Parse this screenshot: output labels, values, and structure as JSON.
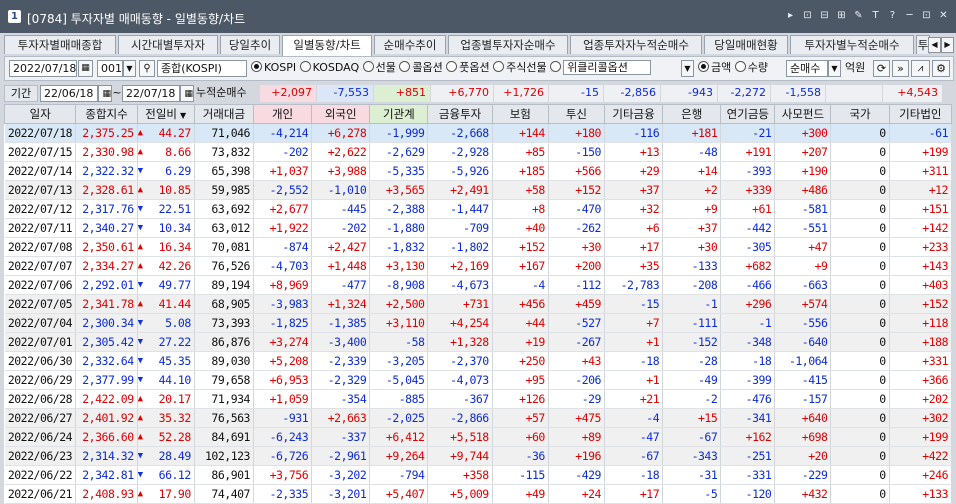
{
  "window": {
    "screen_no": "[0784]",
    "title": "투자자별 매매동향 - 일별동향/차트",
    "controls": [
      "▸",
      "⊡",
      "⊟",
      "⊞",
      "✎",
      "T",
      "?",
      "─",
      "⊡",
      "✕"
    ]
  },
  "tabs": [
    "투자자별매매종합",
    "시간대별투자자",
    "당일추이",
    "일별동향/차트",
    "순매수추이",
    "업종별투자자순매수",
    "업종투자자누적순매수",
    "당일매매현황",
    "투자자별누적순매수",
    "투"
  ],
  "active_tab": "일별동향/차트",
  "toolbar": {
    "date": "2022/07/18",
    "code": "001",
    "index_name": "종합(KOSPI)",
    "markets": [
      "KOSPI",
      "KOSDAQ",
      "선물",
      "콜옵션",
      "풋옵션",
      "주식선물",
      "위클리콜옵션"
    ],
    "market_selected": "KOSPI",
    "amount_types": [
      "금액",
      "수량"
    ],
    "amount_selected": "금액",
    "mode": "순매수",
    "unit": "억원"
  },
  "summary": {
    "period_label": "기간",
    "from": "22/06/18",
    "to": "22/07/18",
    "cum_label": "누적순매수",
    "values": [
      "+2,097",
      "-7,553",
      "+851",
      "+6,770",
      "+1,726",
      "-15",
      "-2,856",
      "-943",
      "-2,272",
      "-1,558",
      "",
      "+4,543"
    ]
  },
  "columns": [
    "일자",
    "종합지수",
    "전일비",
    "거래대금",
    "개인",
    "외국인",
    "기관계",
    "금융투자",
    "보험",
    "투신",
    "기타금융",
    "은행",
    "연기금등",
    "사모펀드",
    "국가",
    "기타법인"
  ],
  "rows": [
    [
      "2022/07/18",
      "2,375.25",
      "up",
      "44.27",
      "71,046",
      "-4,214",
      "+6,278",
      "-1,999",
      "-2,668",
      "+144",
      "+180",
      "-116",
      "+181",
      "-21",
      "+300",
      "0",
      "-61"
    ],
    [
      "2022/07/15",
      "2,330.98",
      "up",
      "8.66",
      "73,832",
      "-202",
      "+2,622",
      "-2,629",
      "-2,928",
      "+85",
      "-150",
      "+13",
      "-48",
      "+191",
      "+207",
      "0",
      "+199"
    ],
    [
      "2022/07/14",
      "2,322.32",
      "dn",
      "6.29",
      "65,398",
      "+1,037",
      "+3,988",
      "-5,335",
      "-5,926",
      "+185",
      "+566",
      "+29",
      "+14",
      "-393",
      "+190",
      "0",
      "+311"
    ],
    [
      "2022/07/13",
      "2,328.61",
      "up",
      "10.85",
      "59,985",
      "-2,552",
      "-1,010",
      "+3,565",
      "+2,491",
      "+58",
      "+152",
      "+37",
      "+2",
      "+339",
      "+486",
      "0",
      "+12"
    ],
    [
      "2022/07/12",
      "2,317.76",
      "dn",
      "22.51",
      "63,692",
      "+2,677",
      "-445",
      "-2,388",
      "-1,447",
      "+8",
      "-470",
      "+32",
      "+9",
      "+61",
      "-581",
      "0",
      "+151"
    ],
    [
      "2022/07/11",
      "2,340.27",
      "dn",
      "10.34",
      "63,012",
      "+1,922",
      "-202",
      "-1,880",
      "-709",
      "+40",
      "-262",
      "+6",
      "+37",
      "-442",
      "-551",
      "0",
      "+142"
    ],
    [
      "2022/07/08",
      "2,350.61",
      "up",
      "16.34",
      "70,081",
      "-874",
      "+2,427",
      "-1,832",
      "-1,802",
      "+152",
      "+30",
      "+17",
      "+30",
      "-305",
      "+47",
      "0",
      "+233"
    ],
    [
      "2022/07/07",
      "2,334.27",
      "up",
      "42.26",
      "76,526",
      "-4,703",
      "+1,448",
      "+3,130",
      "+2,169",
      "+167",
      "+200",
      "+35",
      "-133",
      "+682",
      "+9",
      "0",
      "+143"
    ],
    [
      "2022/07/06",
      "2,292.01",
      "dn",
      "49.77",
      "89,194",
      "+8,969",
      "-477",
      "-8,908",
      "-4,673",
      "-4",
      "-112",
      "-2,783",
      "-208",
      "-466",
      "-663",
      "0",
      "+403"
    ],
    [
      "2022/07/05",
      "2,341.78",
      "up",
      "41.44",
      "68,905",
      "-3,983",
      "+1,324",
      "+2,500",
      "+731",
      "+456",
      "+459",
      "-15",
      "-1",
      "+296",
      "+574",
      "0",
      "+152"
    ],
    [
      "2022/07/04",
      "2,300.34",
      "dn",
      "5.08",
      "73,393",
      "-1,825",
      "-1,385",
      "+3,110",
      "+4,254",
      "+44",
      "-527",
      "+7",
      "-111",
      "-1",
      "-556",
      "0",
      "+118"
    ],
    [
      "2022/07/01",
      "2,305.42",
      "dn",
      "27.22",
      "86,876",
      "+3,274",
      "-3,400",
      "-58",
      "+1,328",
      "+19",
      "-267",
      "+1",
      "-152",
      "-348",
      "-640",
      "0",
      "+188"
    ],
    [
      "2022/06/30",
      "2,332.64",
      "dn",
      "45.35",
      "89,030",
      "+5,208",
      "-2,339",
      "-3,205",
      "-2,370",
      "+250",
      "+43",
      "-18",
      "-28",
      "-18",
      "-1,064",
      "0",
      "+331"
    ],
    [
      "2022/06/29",
      "2,377.99",
      "dn",
      "44.10",
      "79,658",
      "+6,953",
      "-2,329",
      "-5,045",
      "-4,073",
      "+95",
      "-206",
      "+1",
      "-49",
      "-399",
      "-415",
      "0",
      "+366"
    ],
    [
      "2022/06/28",
      "2,422.09",
      "up",
      "20.17",
      "71,934",
      "+1,059",
      "-354",
      "-885",
      "-367",
      "+126",
      "-29",
      "+21",
      "-2",
      "-476",
      "-157",
      "0",
      "+202"
    ],
    [
      "2022/06/27",
      "2,401.92",
      "up",
      "35.32",
      "76,563",
      "-931",
      "+2,663",
      "-2,025",
      "-2,866",
      "+57",
      "+475",
      "-4",
      "+15",
      "-341",
      "+640",
      "0",
      "+302"
    ],
    [
      "2022/06/24",
      "2,366.60",
      "up",
      "52.28",
      "84,691",
      "-6,243",
      "-337",
      "+6,412",
      "+5,518",
      "+60",
      "+89",
      "-47",
      "-67",
      "+162",
      "+698",
      "0",
      "+199"
    ],
    [
      "2022/06/23",
      "2,314.32",
      "dn",
      "28.49",
      "102,123",
      "-6,726",
      "-2,961",
      "+9,264",
      "+9,744",
      "-36",
      "+196",
      "-67",
      "-343",
      "-251",
      "+20",
      "0",
      "+422"
    ],
    [
      "2022/06/22",
      "2,342.81",
      "dn",
      "66.12",
      "86,901",
      "+3,756",
      "-3,202",
      "-794",
      "+358",
      "-115",
      "-429",
      "-18",
      "-31",
      "-331",
      "-229",
      "0",
      "+246"
    ],
    [
      "2022/06/21",
      "2,408.93",
      "up",
      "17.90",
      "74,407",
      "-2,335",
      "-3,201",
      "+5,407",
      "+5,009",
      "+49",
      "+24",
      "+17",
      "-5",
      "-120",
      "+432",
      "0",
      "+133"
    ]
  ],
  "colors": {
    "positive": "#e00000",
    "negative": "#0b2bd6",
    "selected_row": "#d8e8f6",
    "alt_row": "#f0f0f0"
  }
}
